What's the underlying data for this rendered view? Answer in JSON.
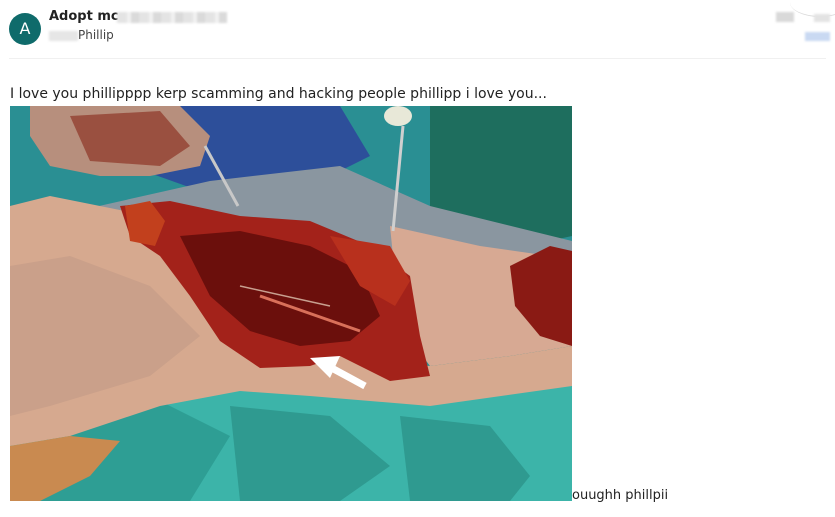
{
  "sender": {
    "avatar_letter": "A",
    "name": "Adopt mc",
    "recipient": "Phillip"
  },
  "message": {
    "text": "I love you phillipppp kerp scamming and hacking people phillipp i love you...",
    "caption": "ouughh phillpii"
  },
  "colors": {
    "avatar_bg": "#0f6b6b",
    "drape_green": "#3fb7ab",
    "tissue_red": "#a3221a"
  }
}
